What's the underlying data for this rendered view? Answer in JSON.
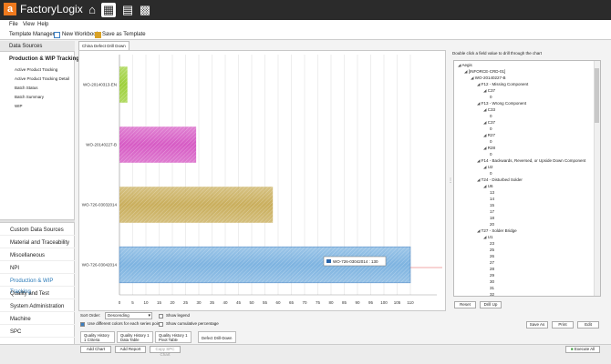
{
  "app": {
    "logo_letter": "a",
    "brand": "FactoryLogix"
  },
  "menu": [
    "File",
    "View",
    "Help"
  ],
  "toolbar": {
    "template_manager": "Template Manager",
    "new_workbook": "New Workbook",
    "save_as_template": "Save as Template"
  },
  "data_sources": {
    "header": "Data Sources",
    "group": "Production & WIP Tracking",
    "items": [
      "Active Product Tracking",
      "Active Product Tracking Detail",
      "Batch Status",
      "Batch Summary",
      "WIP"
    ]
  },
  "nav": [
    "Custom Data Sources",
    "Material and Traceability",
    "Miscellaneous",
    "NPI",
    "Production & WIP Tracking",
    "Quality and Test",
    "System Administration",
    "Machine",
    "SPC"
  ],
  "nav_active": "Production & WIP Tracking",
  "doc_tab": "China Defect Drill Down",
  "chart_data": {
    "type": "bar",
    "orientation": "horizontal",
    "categories": [
      "WO-20140313-EN",
      "WO-20140227-B",
      "WO-726-03032014",
      "WO-726-03042014"
    ],
    "values": [
      3,
      29,
      58,
      110
    ],
    "colors": [
      "#9dd03a",
      "#d65bc4",
      "#c9ae5c",
      "#7db3e0"
    ],
    "xlim": [
      0,
      120
    ],
    "xticks": [
      0,
      5,
      10,
      15,
      20,
      25,
      30,
      35,
      40,
      45,
      50,
      55,
      60,
      65,
      70,
      75,
      80,
      85,
      90,
      95,
      100,
      105,
      110
    ],
    "tooltip": "WO-726-03042014 : 130",
    "grid": true
  },
  "right_panel": {
    "instruction": "Double click a field value to drill through the chart",
    "reset": "Reset",
    "drill_up": "Drill Up"
  },
  "tree": [
    {
      "level": 0,
      "text": "Aegis"
    },
    {
      "level": 1,
      "text": "[INFORCE-CRD-01]"
    },
    {
      "level": 2,
      "text": "WO-20140227-B"
    },
    {
      "level": 3,
      "text": "F12 - Missing Component"
    },
    {
      "level": 4,
      "text": "C37"
    },
    {
      "level": 5,
      "text": "0"
    },
    {
      "level": 3,
      "text": "F13 - Wrong Component"
    },
    {
      "level": 4,
      "text": "C33"
    },
    {
      "level": 5,
      "text": "0"
    },
    {
      "level": 4,
      "text": "C37"
    },
    {
      "level": 5,
      "text": "0"
    },
    {
      "level": 4,
      "text": "R27"
    },
    {
      "level": 5,
      "text": "0"
    },
    {
      "level": 4,
      "text": "R28"
    },
    {
      "level": 5,
      "text": "0"
    },
    {
      "level": 3,
      "text": "F14 - Backwards, Reversed, or Upside Down Component"
    },
    {
      "level": 4,
      "text": "U2"
    },
    {
      "level": 5,
      "text": "0"
    },
    {
      "level": 3,
      "text": "T24 - Disturbed Solder"
    },
    {
      "level": 4,
      "text": "U6"
    },
    {
      "level": 5,
      "text": "13"
    },
    {
      "level": 5,
      "text": "14"
    },
    {
      "level": 5,
      "text": "15"
    },
    {
      "level": 5,
      "text": "17"
    },
    {
      "level": 5,
      "text": "18"
    },
    {
      "level": 5,
      "text": "20"
    },
    {
      "level": 3,
      "text": "T27 - Solder Bridge"
    },
    {
      "level": 4,
      "text": "U1"
    },
    {
      "level": 5,
      "text": "23"
    },
    {
      "level": 5,
      "text": "25"
    },
    {
      "level": 5,
      "text": "26"
    },
    {
      "level": 5,
      "text": "27"
    },
    {
      "level": 5,
      "text": "28"
    },
    {
      "level": 5,
      "text": "29"
    },
    {
      "level": 5,
      "text": "30"
    },
    {
      "level": 5,
      "text": "31"
    },
    {
      "level": 5,
      "text": "32"
    }
  ],
  "controls": {
    "sort_order_label": "Sort Order:",
    "sort_order_value": "Descending",
    "show_legend": "Show legend",
    "diff_colors": "Use different colors for each series point",
    "cumulative": "Show cumulative percentage",
    "save_as": "Save As",
    "print": "Print",
    "edit": "Edit"
  },
  "bottom_tabs": [
    "Quality History 1 Criteria",
    "Quality History 1 Data Table",
    "Quality History 1 Pivot Table",
    "Defect Drill-Down"
  ],
  "status_buttons": {
    "add_chart": "Add Chart",
    "add_report": "Add Report",
    "copy_spc": "Copy SPC Chart",
    "execute_all": "Execute All"
  }
}
